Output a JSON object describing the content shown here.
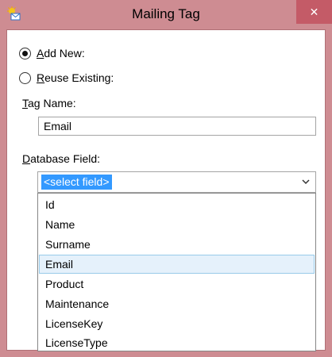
{
  "window": {
    "title": "Mailing Tag",
    "close_label": "✕"
  },
  "form": {
    "add_new_label": "Add New:",
    "add_new_selected": true,
    "reuse_existing_label": "Reuse Existing:",
    "reuse_existing_selected": false,
    "tag_name_label": "Tag Name:",
    "tag_name_value": "Email",
    "database_field_label": "Database Field:",
    "database_field_selected": "<select field>"
  },
  "dropdown": {
    "items": [
      "Id",
      "Name",
      "Surname",
      "Email",
      "Product",
      "Maintenance",
      "LicenseKey",
      "LicenseType"
    ],
    "highlighted": "Email"
  },
  "colors": {
    "window_frame": "#ce8c92",
    "close_button": "#c45b67",
    "selection": "#3399ff",
    "hover": "#e5f1fb"
  }
}
